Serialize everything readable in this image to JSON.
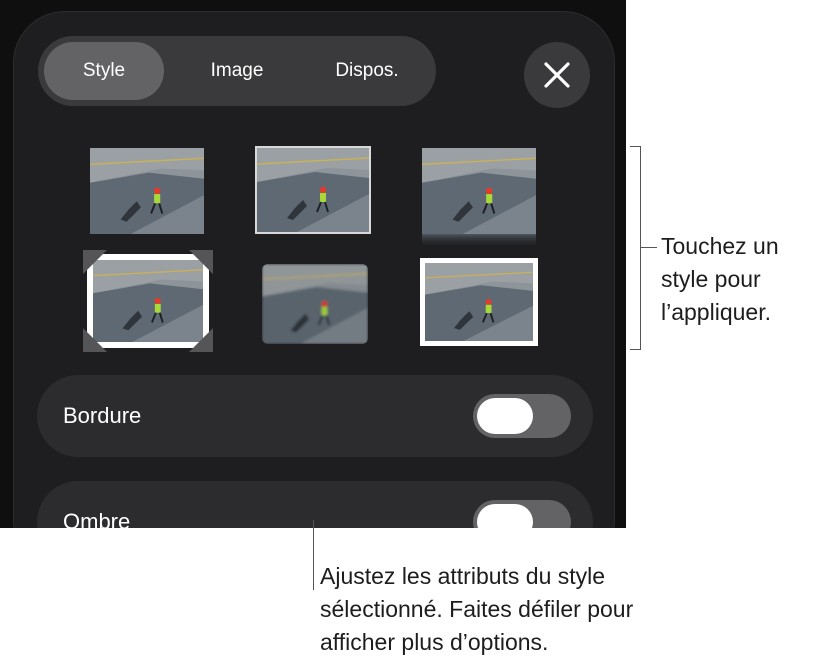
{
  "tabs": [
    {
      "label": "Style",
      "active": true
    },
    {
      "label": "Image",
      "active": false
    },
    {
      "label": "Dispos.",
      "active": false
    }
  ],
  "close_icon": "close-icon",
  "styles": [
    {
      "name": "plain"
    },
    {
      "name": "thin-border"
    },
    {
      "name": "reflection"
    },
    {
      "name": "photo-corners"
    },
    {
      "name": "soft-edge"
    },
    {
      "name": "thick-border"
    }
  ],
  "rows": [
    {
      "label": "Bordure",
      "toggle_on": false
    },
    {
      "label": "Ombre",
      "toggle_on": false
    }
  ],
  "callouts": {
    "styles_line1": "Touchez un",
    "styles_line2": "style pour",
    "styles_line3": "l’appliquer.",
    "attrs_line1": "Ajustez les attributs du style",
    "attrs_line2": "sélectionné. Faites défiler pour",
    "attrs_line3": "afficher plus d’options."
  },
  "colors": {
    "panel": "#1e1e20",
    "control": "#3a3a3c",
    "selected_tab": "#636366"
  }
}
